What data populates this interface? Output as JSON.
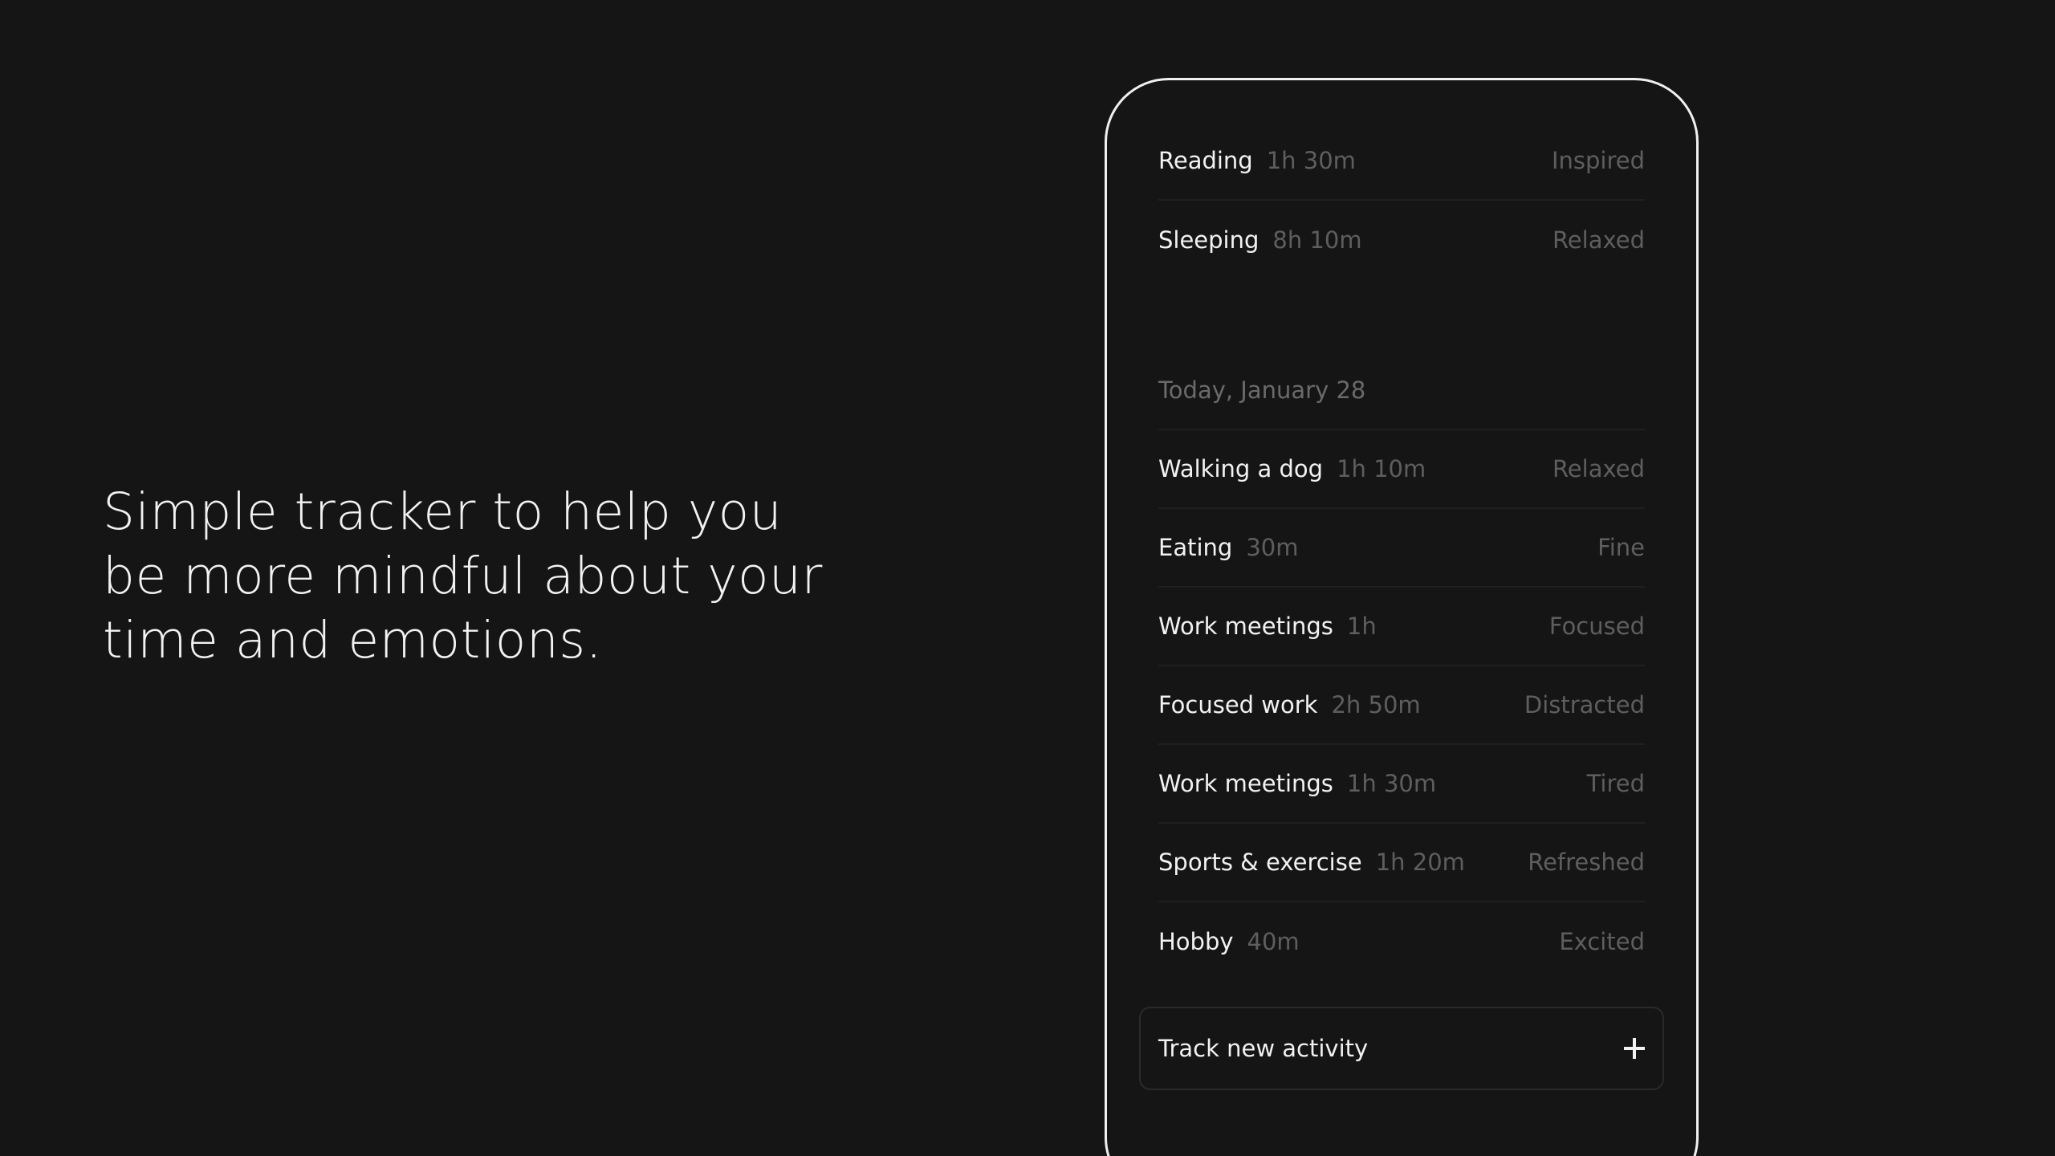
{
  "tagline": {
    "lines": [
      "Simple tracker to help you",
      "be more mindful about your",
      "time and emotions."
    ]
  },
  "app": {
    "previous_entries": [
      {
        "activity": "Reading",
        "duration": "1h 30m",
        "mood": "Inspired"
      },
      {
        "activity": "Sleeping",
        "duration": "8h 10m",
        "mood": "Relaxed"
      }
    ],
    "today": {
      "date_label": "Today, January 28",
      "entries": [
        {
          "activity": "Walking a dog",
          "duration": "1h 10m",
          "mood": "Relaxed"
        },
        {
          "activity": "Eating",
          "duration": "30m",
          "mood": "Fine"
        },
        {
          "activity": "Work meetings",
          "duration": "1h",
          "mood": "Focused"
        },
        {
          "activity": "Focused work",
          "duration": "2h 50m",
          "mood": "Distracted"
        },
        {
          "activity": "Work meetings",
          "duration": "1h 30m",
          "mood": "Tired"
        },
        {
          "activity": "Sports & exercise",
          "duration": "1h 20m",
          "mood": "Refreshed"
        },
        {
          "activity": "Hobby",
          "duration": "40m",
          "mood": "Excited"
        }
      ]
    },
    "track_button": {
      "label": "Track new activity",
      "icon": "plus-icon"
    }
  },
  "colors": {
    "background": "#151515",
    "primary_text": "#f2f2f2",
    "secondary_text": "#5e5e5e",
    "divider": "#202020"
  }
}
